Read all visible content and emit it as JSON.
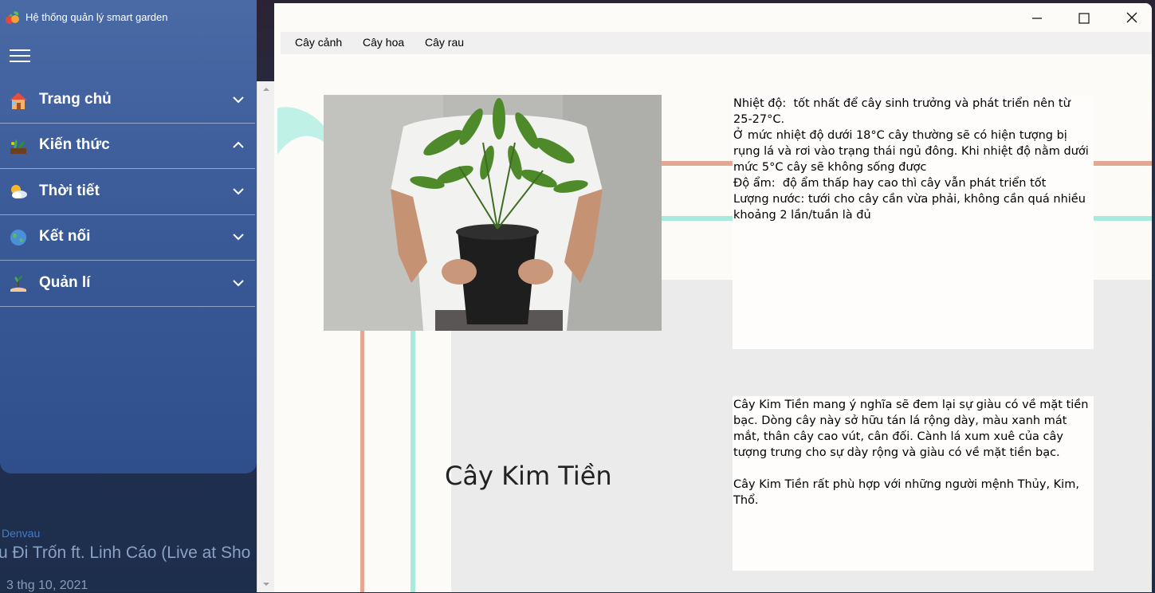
{
  "app": {
    "title": "Hệ thống quản lý smart garden"
  },
  "sidebar": {
    "items": [
      {
        "label": "Trang chủ",
        "icon": "house-icon",
        "expanded": false
      },
      {
        "label": "Kiến thức",
        "icon": "plant-knowledge-icon",
        "expanded": true
      },
      {
        "label": "Thời tiết",
        "icon": "weather-icon",
        "expanded": false
      },
      {
        "label": "Kết nối",
        "icon": "globe-icon",
        "expanded": false
      },
      {
        "label": "Quản lí",
        "icon": "manage-plant-icon",
        "expanded": false
      }
    ]
  },
  "media": {
    "artist": "Denvau",
    "song": "u Đi Trốn ft. Linh Cáo (Live at Sho",
    "date": "3 thg 10, 2021"
  },
  "menu": {
    "items": [
      "Cây cảnh",
      "Cây hoa",
      "Cây rau"
    ]
  },
  "plant": {
    "name": "Cây Kim Tiền",
    "info": "Nhiệt độ:  tốt nhất để cây sinh trưởng và phát triển nên từ 25-27°C.\nỞ mức nhiệt độ dưới 18°C cây thường sẽ có hiện tượng bị rụng lá và rơi vào trạng thái ngủ đông. Khi nhiệt độ nằm dưới mức 5°C cây sẽ không sống được\nĐộ ẩm:  độ ẩm thấp hay cao thì cây vẫn phát triển tốt\nLượng nước: tưới cho cây cần vừa phải, không cần quá nhiều khoảng 2 lần/tuần là đủ",
    "description": "Cây Kim Tiền mang ý nghĩa sẽ đem lại sự giàu có về mặt tiền bạc. Dòng cây này sở hữu tán lá rộng dày, màu xanh mát mắt, thân cây cao vút, cân đối. Cành lá xum xuê của cây tượng trưng cho sự dày rộng và giàu có về mặt tiền bạc.\n\nCây Kim Tiền rất phù hợp với những người mệnh Thủy, Kim, Thổ."
  },
  "colors": {
    "sidebar_top": "#4a6aa6",
    "sidebar_bottom": "#2f4f8c",
    "deco_salmon": "#e0a58f",
    "deco_mint": "#a8eadb",
    "deco_grey": "#ebebeb"
  }
}
